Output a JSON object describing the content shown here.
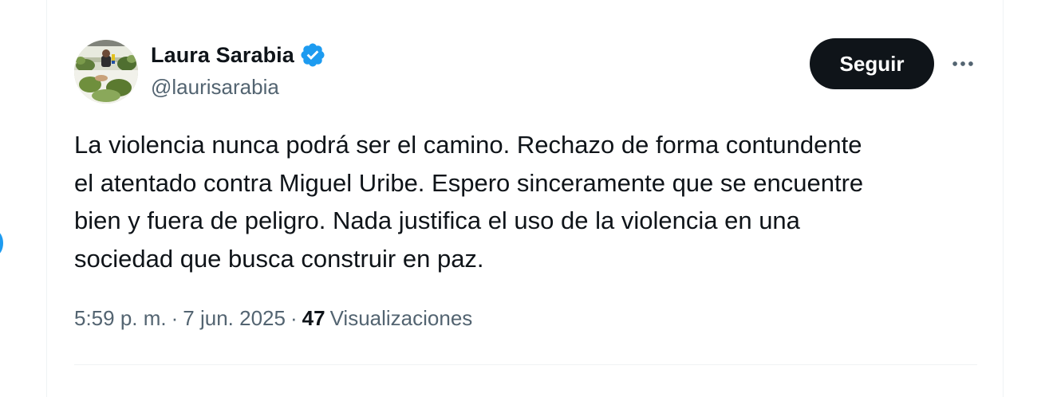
{
  "author": {
    "display_name": "Laura Sarabia",
    "handle": "@laurisarabia",
    "verified_icon": "verified-badge-icon",
    "avatar_icon": "profile-photo"
  },
  "actions": {
    "follow_label": "Seguir",
    "more_icon": "more-options-icon"
  },
  "tweet": {
    "text": "La violencia nunca podrá ser el camino. Rechazo de forma contundente\nel atentado contra Miguel Uribe. Espero sinceramente que se encuentre\nbien y fuera de peligro. Nada justifica el uso de la violencia en una\nsociedad que busca construir en paz."
  },
  "meta": {
    "time": "5:59 p. m.",
    "separator": "·",
    "date": "7 jun. 2025",
    "views_count": "47",
    "views_label": "Visualizaciones"
  },
  "colors": {
    "accent": "#1d9bf0",
    "text_primary": "#0f1419",
    "text_secondary": "#536471",
    "button_bg": "#0f1419",
    "divider": "#eff3f4"
  }
}
